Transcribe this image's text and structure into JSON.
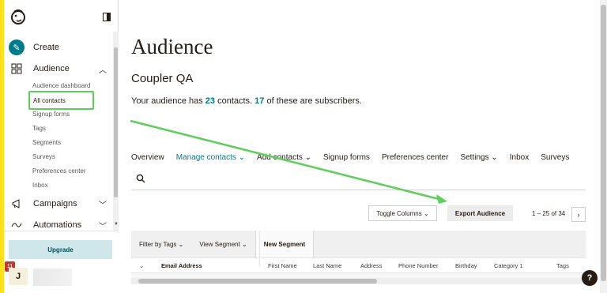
{
  "sidebar": {
    "nav": {
      "create": "Create",
      "audience": "Audience",
      "campaigns": "Campaigns",
      "automations": "Automations"
    },
    "audience_sub": [
      "Audience dashboard",
      "All contacts",
      "Signup forms",
      "Tags",
      "Segments",
      "Surveys",
      "Preferences center",
      "Inbox"
    ],
    "upgrade_label": "Upgrade",
    "notification_count": "11",
    "avatar_initial": "J"
  },
  "main": {
    "title": "Audience",
    "audience_name": "Coupler QA",
    "summary": {
      "prefix": "Your audience has ",
      "contacts": "23",
      "middle": " contacts. ",
      "subscribers": "17",
      "suffix": " of these are subscribers."
    },
    "tabs": [
      "Overview",
      "Manage contacts",
      "Add contacts",
      "Signup forms",
      "Preferences center",
      "Settings",
      "Inbox",
      "Surveys"
    ],
    "toggle_columns_label": "Toggle Columns",
    "export_label": "Export Audience",
    "pagination": "1 – 25 of 34",
    "filter_by_tags": "Filter by Tags",
    "view_segment": "View Segment",
    "new_segment": "New Segment",
    "columns": [
      "Email Address",
      "First Name",
      "Last Name",
      "Address",
      "Phone Number",
      "Birthday",
      "Category 1",
      "Tags"
    ]
  },
  "colors": {
    "accent": "#007c89",
    "highlight": "#5ecf5a",
    "brand_yellow": "#ffe01b"
  }
}
